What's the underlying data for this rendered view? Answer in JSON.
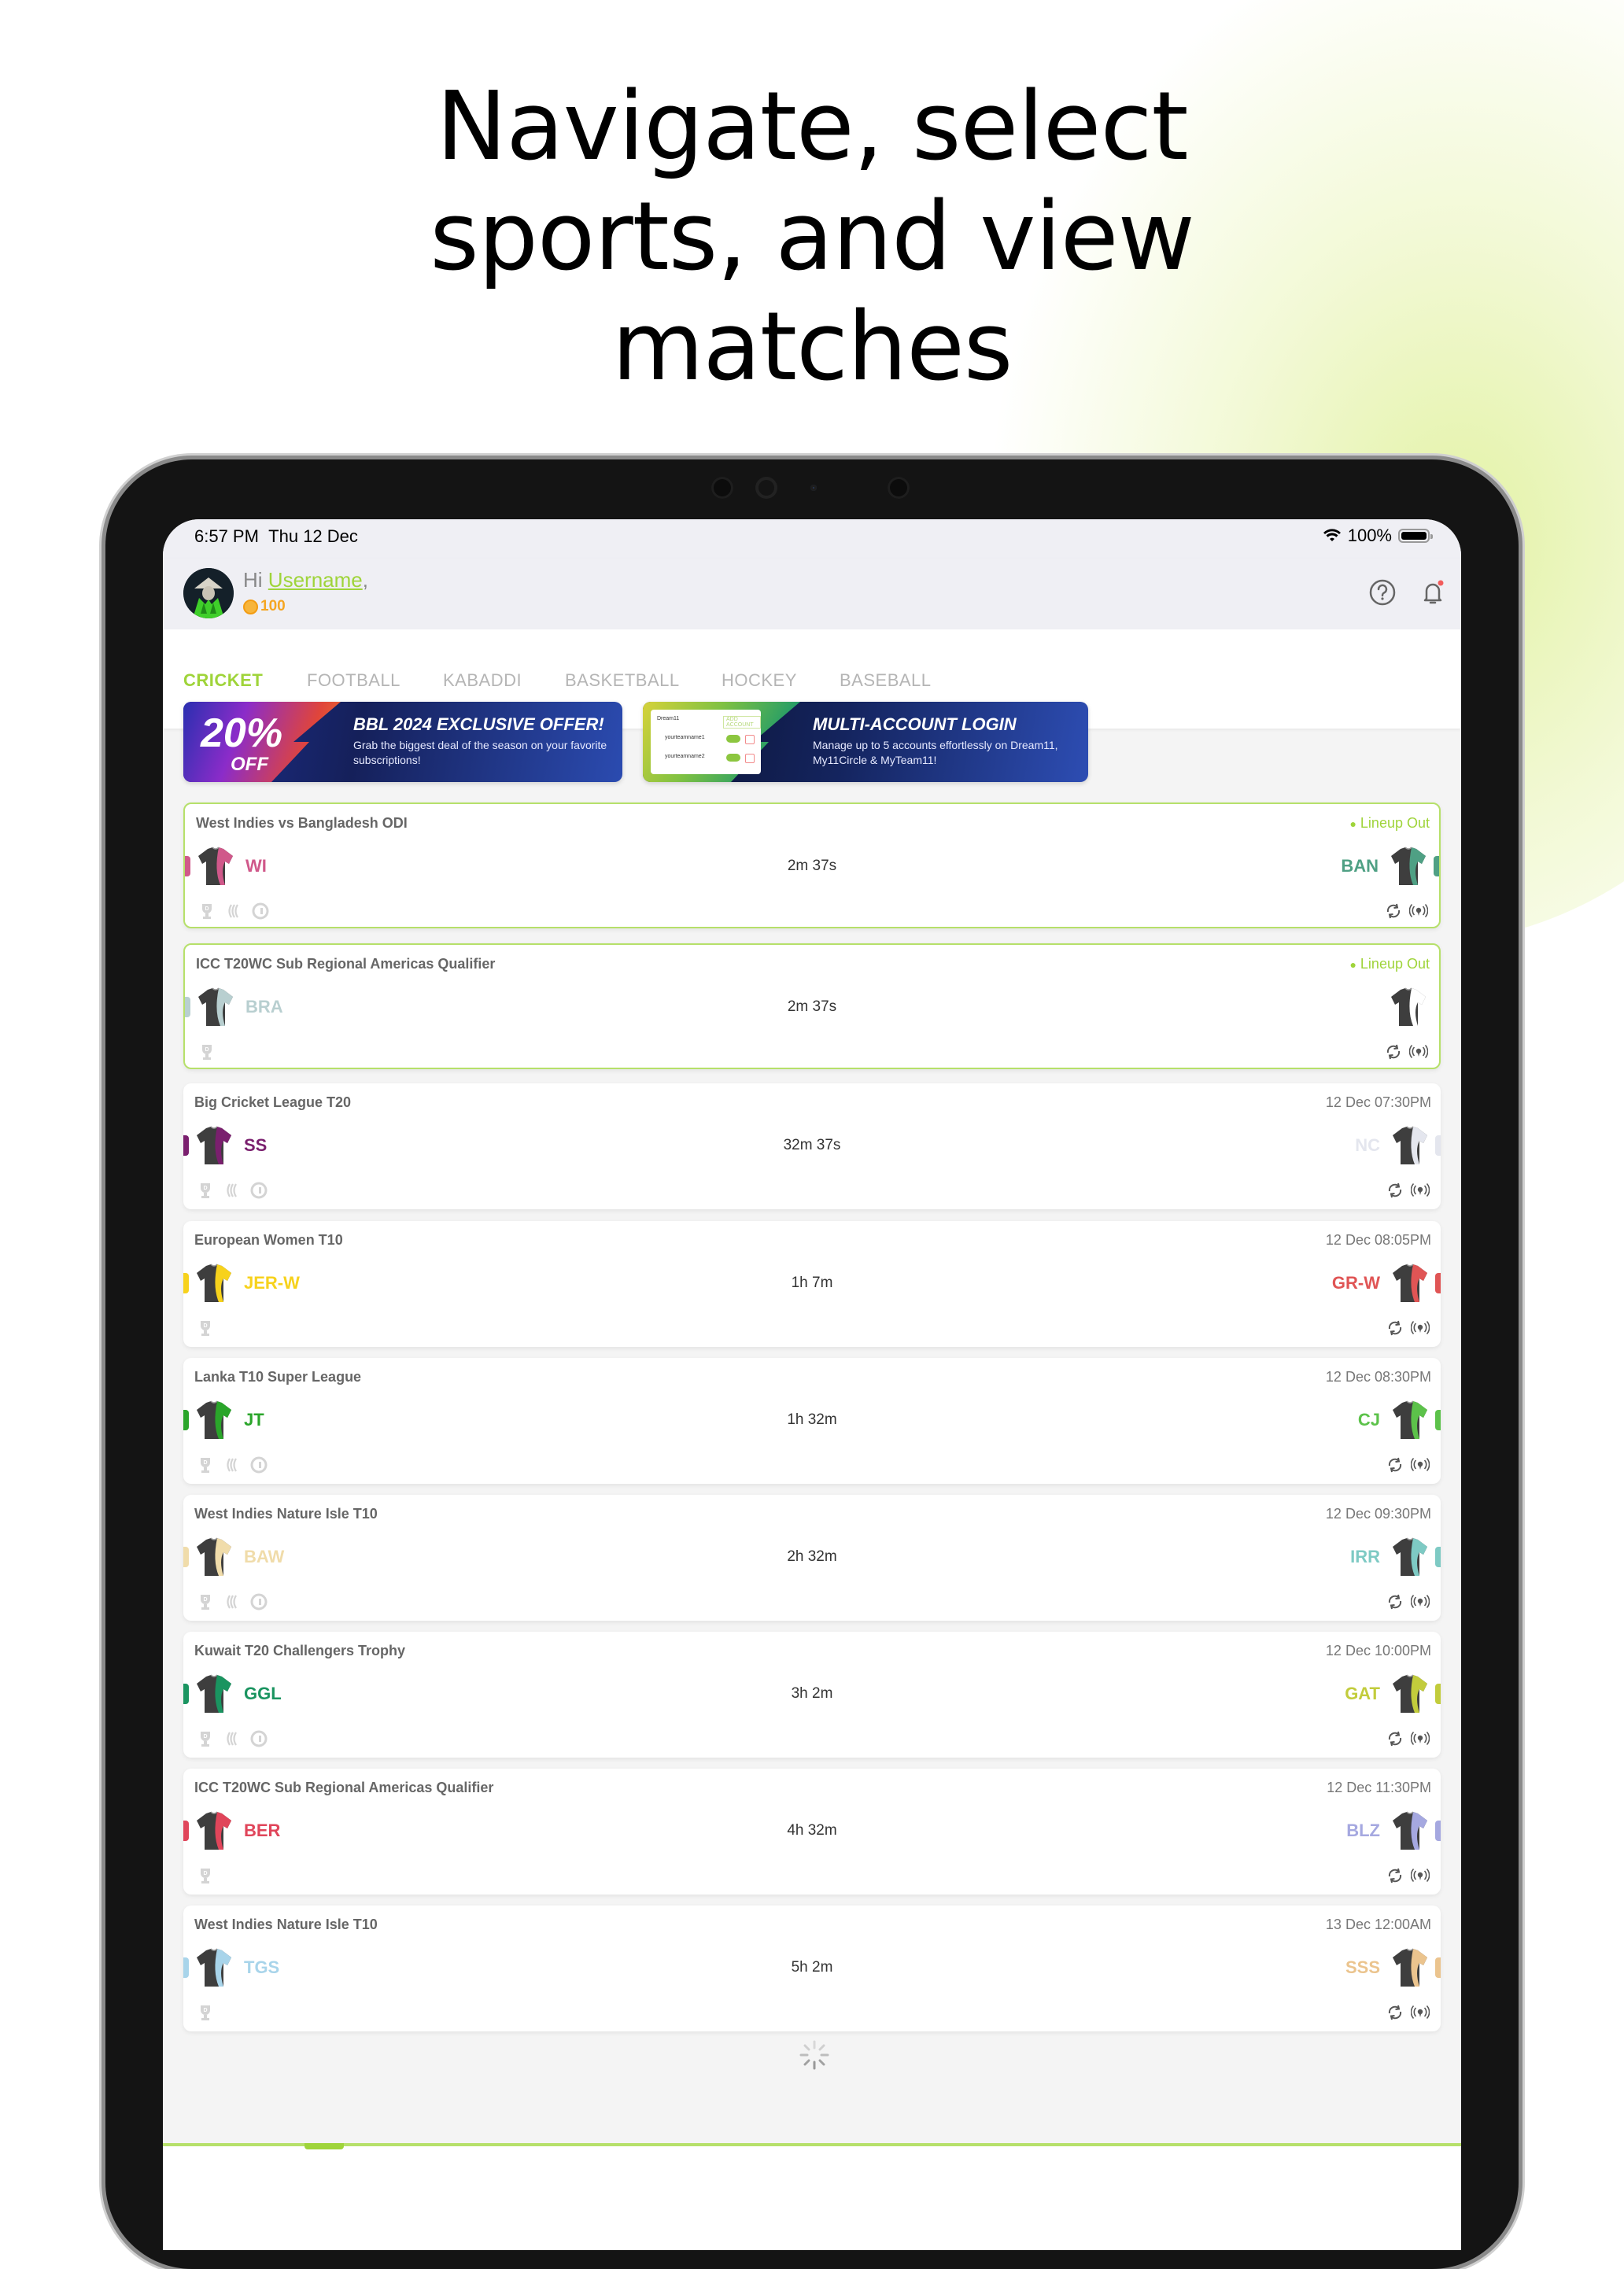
{
  "headline": [
    "Navigate, select",
    "sports, and view",
    "matches"
  ],
  "status_bar": {
    "time": "6:57 PM",
    "date": "Thu 12 Dec",
    "battery": "100%",
    "battery_level": 100
  },
  "header": {
    "greeting": "Hi",
    "username": "Username",
    "comma": ",",
    "coins": "100",
    "help_icon": "help-circle-icon",
    "bell_icon": "bell-icon",
    "notification_dot_color": "#f25c5c"
  },
  "tabs": [
    {
      "label": "CRICKET",
      "active": true
    },
    {
      "label": "FOOTBALL",
      "active": false
    },
    {
      "label": "KABADDI",
      "active": false
    },
    {
      "label": "BASKETBALL",
      "active": false
    },
    {
      "label": "HOCKEY",
      "active": false
    },
    {
      "label": "BASEBALL",
      "active": false
    }
  ],
  "banners": [
    {
      "badge_value": "20%",
      "badge_label": "OFF",
      "title": "BBL 2024 EXCLUSIVE OFFER!",
      "subtitle": "Grab the biggest deal of the season on your favorite subscriptions!"
    },
    {
      "title": "MULTI-ACCOUNT LOGIN",
      "subtitle": "Manage up to 5 accounts effortlessly on Dream11, My11Circle & MyTeam11!",
      "mock": {
        "app": "Dream11",
        "add_label": "ADD ACCOUNT",
        "rows": [
          "yourteamname1",
          "yourteamname2"
        ]
      }
    }
  ],
  "accent_color": "#9fd43a",
  "matches": [
    {
      "league": "West Indies vs Bangladesh ODI",
      "status": "Lineup Out",
      "lineup": true,
      "time": "2m 37s",
      "left": {
        "code": "WI",
        "color": "#d0588a"
      },
      "right": {
        "code": "BAN",
        "color": "#4fa084"
      },
      "platforms": [
        "dream11",
        "my11circle",
        "myteam11"
      ]
    },
    {
      "league": "ICC T20WC Sub Regional Americas Qualifier",
      "status": "Lineup Out",
      "lineup": true,
      "time": "2m 37s",
      "left": {
        "code": "BRA",
        "color": "#b8cfd0"
      },
      "right": {
        "code": "",
        "color": "#ffffff"
      },
      "platforms": [
        "dream11"
      ]
    },
    {
      "league": "Big Cricket League T20",
      "status": "12 Dec 07:30PM",
      "lineup": false,
      "time": "32m 37s",
      "left": {
        "code": "SS",
        "color": "#7a1f6e"
      },
      "right": {
        "code": "NC",
        "color": "#e4e6ee"
      },
      "platforms": [
        "dream11",
        "my11circle",
        "myteam11"
      ]
    },
    {
      "league": "European  Women T10",
      "status": "12 Dec 08:05PM",
      "lineup": false,
      "time": "1h 7m",
      "left": {
        "code": "JER-W",
        "color": "#f7d21c"
      },
      "right": {
        "code": "GR-W",
        "color": "#e05555"
      },
      "platforms": [
        "dream11"
      ]
    },
    {
      "league": "Lanka T10 Super League",
      "status": "12 Dec 08:30PM",
      "lineup": false,
      "time": "1h 32m",
      "left": {
        "code": "JT",
        "color": "#2aa52a"
      },
      "right": {
        "code": "CJ",
        "color": "#5cc24a"
      },
      "platforms": [
        "dream11",
        "my11circle",
        "myteam11"
      ]
    },
    {
      "league": "West Indies Nature Isle T10",
      "status": "12 Dec 09:30PM",
      "lineup": false,
      "time": "2h 32m",
      "left": {
        "code": "BAW",
        "color": "#f0dcaa"
      },
      "right": {
        "code": "IRR",
        "color": "#7ecac4"
      },
      "platforms": [
        "dream11",
        "my11circle",
        "myteam11"
      ]
    },
    {
      "league": "Kuwait T20 Challengers Trophy",
      "status": "12 Dec 10:00PM",
      "lineup": false,
      "time": "3h 2m",
      "left": {
        "code": "GGL",
        "color": "#1a9460"
      },
      "right": {
        "code": "GAT",
        "color": "#c2cc3c"
      },
      "platforms": [
        "dream11",
        "my11circle",
        "myteam11"
      ]
    },
    {
      "league": "ICC T20WC Sub Regional Americas Qualifier",
      "status": "12 Dec 11:30PM",
      "lineup": false,
      "time": "4h 32m",
      "left": {
        "code": "BER",
        "color": "#e0455a"
      },
      "right": {
        "code": "BLZ",
        "color": "#a5a8e0"
      },
      "platforms": [
        "dream11"
      ]
    },
    {
      "league": "West Indies Nature Isle T10",
      "status": "13 Dec 12:00AM",
      "lineup": false,
      "time": "5h 2m",
      "left": {
        "code": "TGS",
        "color": "#a8d4ea"
      },
      "right": {
        "code": "SSS",
        "color": "#ebc48e"
      },
      "platforms": [
        "dream11"
      ]
    }
  ]
}
